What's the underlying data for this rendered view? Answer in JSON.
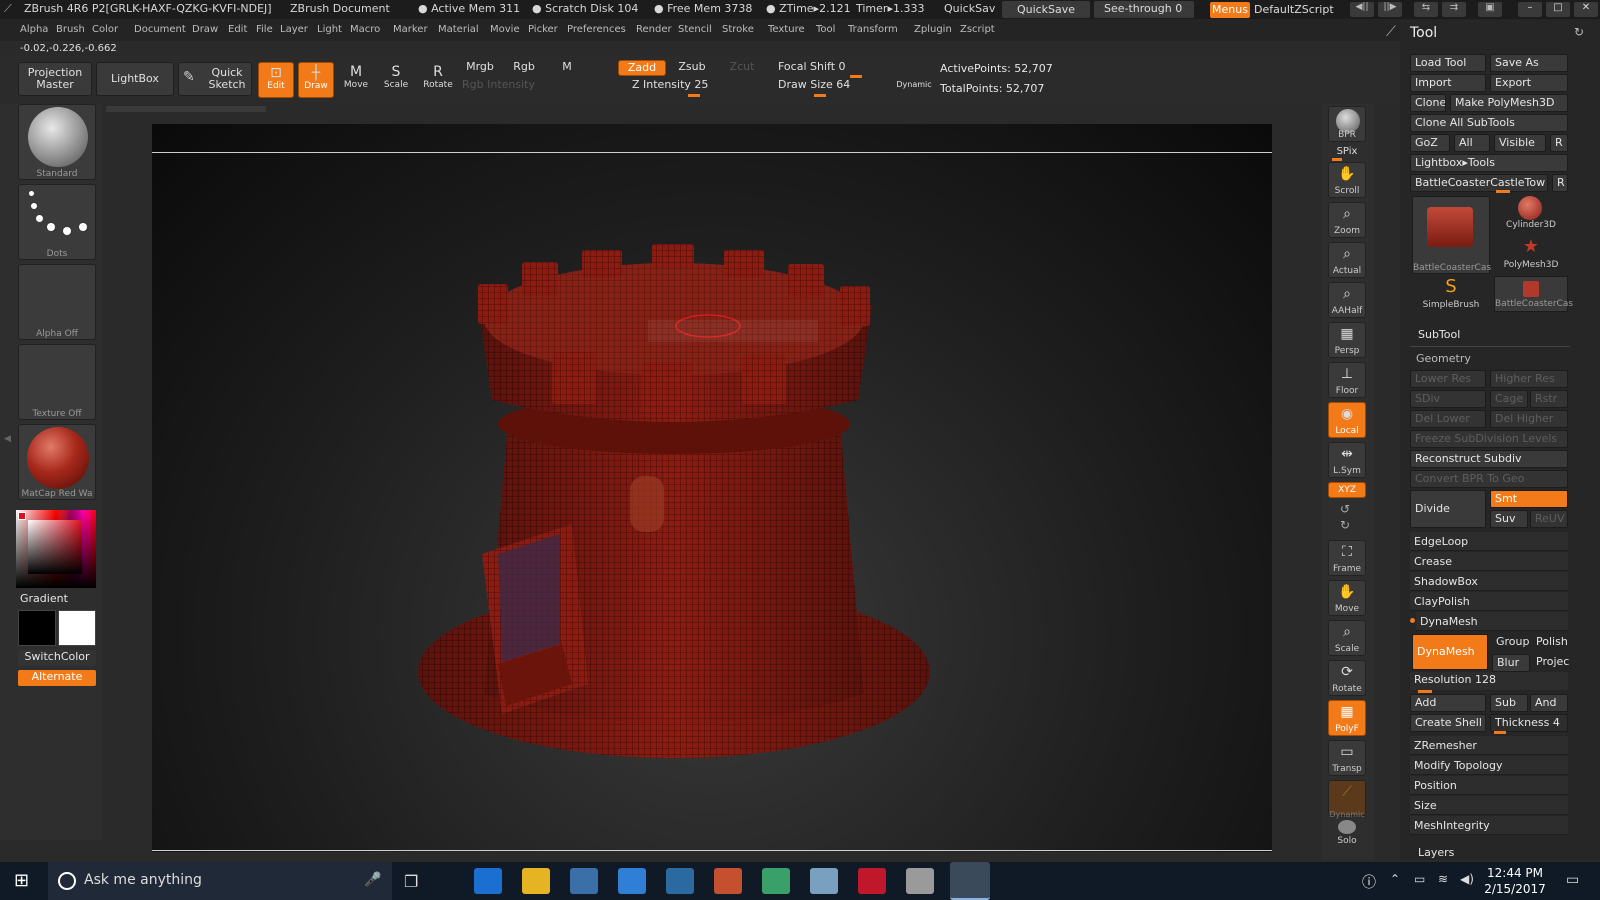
{
  "titlebar": {
    "app": "ZBrush 4R6 P2[GRLK-HAXF-QZKG-KVFI-NDEJ]",
    "document": "ZBrush Document",
    "active_mem": "● Active Mem 311",
    "scratch_disk": "● Scratch Disk 104",
    "free_mem": "● Free Mem 3738",
    "ztime": "● ZTime▸2.121",
    "timer": "Timer▸1.333",
    "quicksav": "QuickSav",
    "quicksave_btn": "QuickSave",
    "seethrough": "See-through  0",
    "menus": "Menus",
    "script": "DefaultZScript"
  },
  "menu": [
    "Alpha",
    "Brush",
    "Color",
    "Document",
    "Draw",
    "Edit",
    "File",
    "Layer",
    "Light",
    "Macro",
    "Marker",
    "Material",
    "Movie",
    "Picker",
    "Preferences",
    "Render",
    "Stencil",
    "Stroke",
    "Texture",
    "Tool",
    "Transform",
    "Zplugin",
    "Zscript"
  ],
  "coords": "-0.02,-0.226,-0.662",
  "toolbar": {
    "projection_master": "Projection Master",
    "lightbox": "LightBox",
    "quick_sketch": "Quick Sketch",
    "edit": "Edit",
    "draw": "Draw",
    "move": "Move",
    "scale": "Scale",
    "rotate": "Rotate",
    "mrgb": "Mrgb",
    "rgb": "Rgb",
    "m": "M",
    "rgb_intensity": "Rgb Intensity",
    "zadd": "Zadd",
    "zsub": "Zsub",
    "zcut": "Zcut",
    "z_intensity": "Z Intensity 25",
    "focal_shift": "Focal Shift 0",
    "draw_size": "Draw Size 64",
    "dynamic": "Dynamic",
    "active_points": "ActivePoints: 52,707",
    "total_points": "TotalPoints: 52,707"
  },
  "left": {
    "brush": "Standard",
    "stroke": "Dots",
    "alpha": "Alpha Off",
    "texture": "Texture Off",
    "material": "MatCap Red Wa",
    "gradient": "Gradient",
    "switchcolor": "SwitchColor",
    "alternate": "Alternate"
  },
  "right_shelf": [
    "BPR",
    "SPix",
    "Scroll",
    "Zoom",
    "Actual",
    "AAHalf",
    "Persp",
    "Floor",
    "Local",
    "L.Sym",
    "XYZ",
    "Frame",
    "Move",
    "Scale",
    "Rotate",
    "PolyF",
    "Transp",
    "Dynamic",
    "Solo"
  ],
  "tool": {
    "title": "Tool",
    "load_tool": "Load Tool",
    "save_as": "Save As",
    "import": "Import",
    "export": "Export",
    "clone": "Clone",
    "make_polymesh": "Make PolyMesh3D",
    "clone_all": "Clone All SubTools",
    "goz": "GoZ",
    "all": "All",
    "visible": "Visible",
    "r": "R",
    "lightbox_tools": "Lightbox▸Tools",
    "current_tool": "BattleCoasterCastleTow",
    "thumb_main": "BattleCoasterCas",
    "thumb_cyl": "Cylinder3D",
    "thumb_poly": "PolyMesh3D",
    "thumb_simple": "SimpleBrush",
    "thumb_castle": "BattleCoasterCas",
    "subtool": "SubTool",
    "geometry": "Geometry",
    "lower_res": "Lower Res",
    "higher_res": "Higher Res",
    "sdiv": "SDiv",
    "cage": "Cage",
    "rstr": "Rstr",
    "del_lower": "Del Lower",
    "del_higher": "Del Higher",
    "freeze": "Freeze SubDivision Levels",
    "reconstruct": "Reconstruct Subdiv",
    "convert_bpr": "Convert BPR To Geo",
    "divide": "Divide",
    "smt": "Smt",
    "suv": "Suv",
    "reuv": "ReUV",
    "edgeloop": "EdgeLoop",
    "crease": "Crease",
    "shadowbox": "ShadowBox",
    "claypolish": "ClayPolish",
    "dynamesh_head": "DynaMesh",
    "dynamesh_btn": "DynaMesh",
    "group": "Group",
    "polish": "Polish",
    "blur": "Blur",
    "project": "Projec",
    "resolution": "Resolution 128",
    "add": "Add",
    "sub": "Sub",
    "and": "And",
    "create_shell": "Create Shell",
    "thickness": "Thickness 4",
    "zremesher": "ZRemesher",
    "modify_topology": "Modify Topology",
    "position": "Position",
    "size": "Size",
    "meshintegrity": "MeshIntegrity",
    "layers": "Layers"
  },
  "taskbar": {
    "search": "Ask me anything",
    "time": "12:44 PM",
    "date": "2/15/2017"
  },
  "colors": {
    "accent": "#f27a19",
    "mesh": "#8c1c12"
  }
}
